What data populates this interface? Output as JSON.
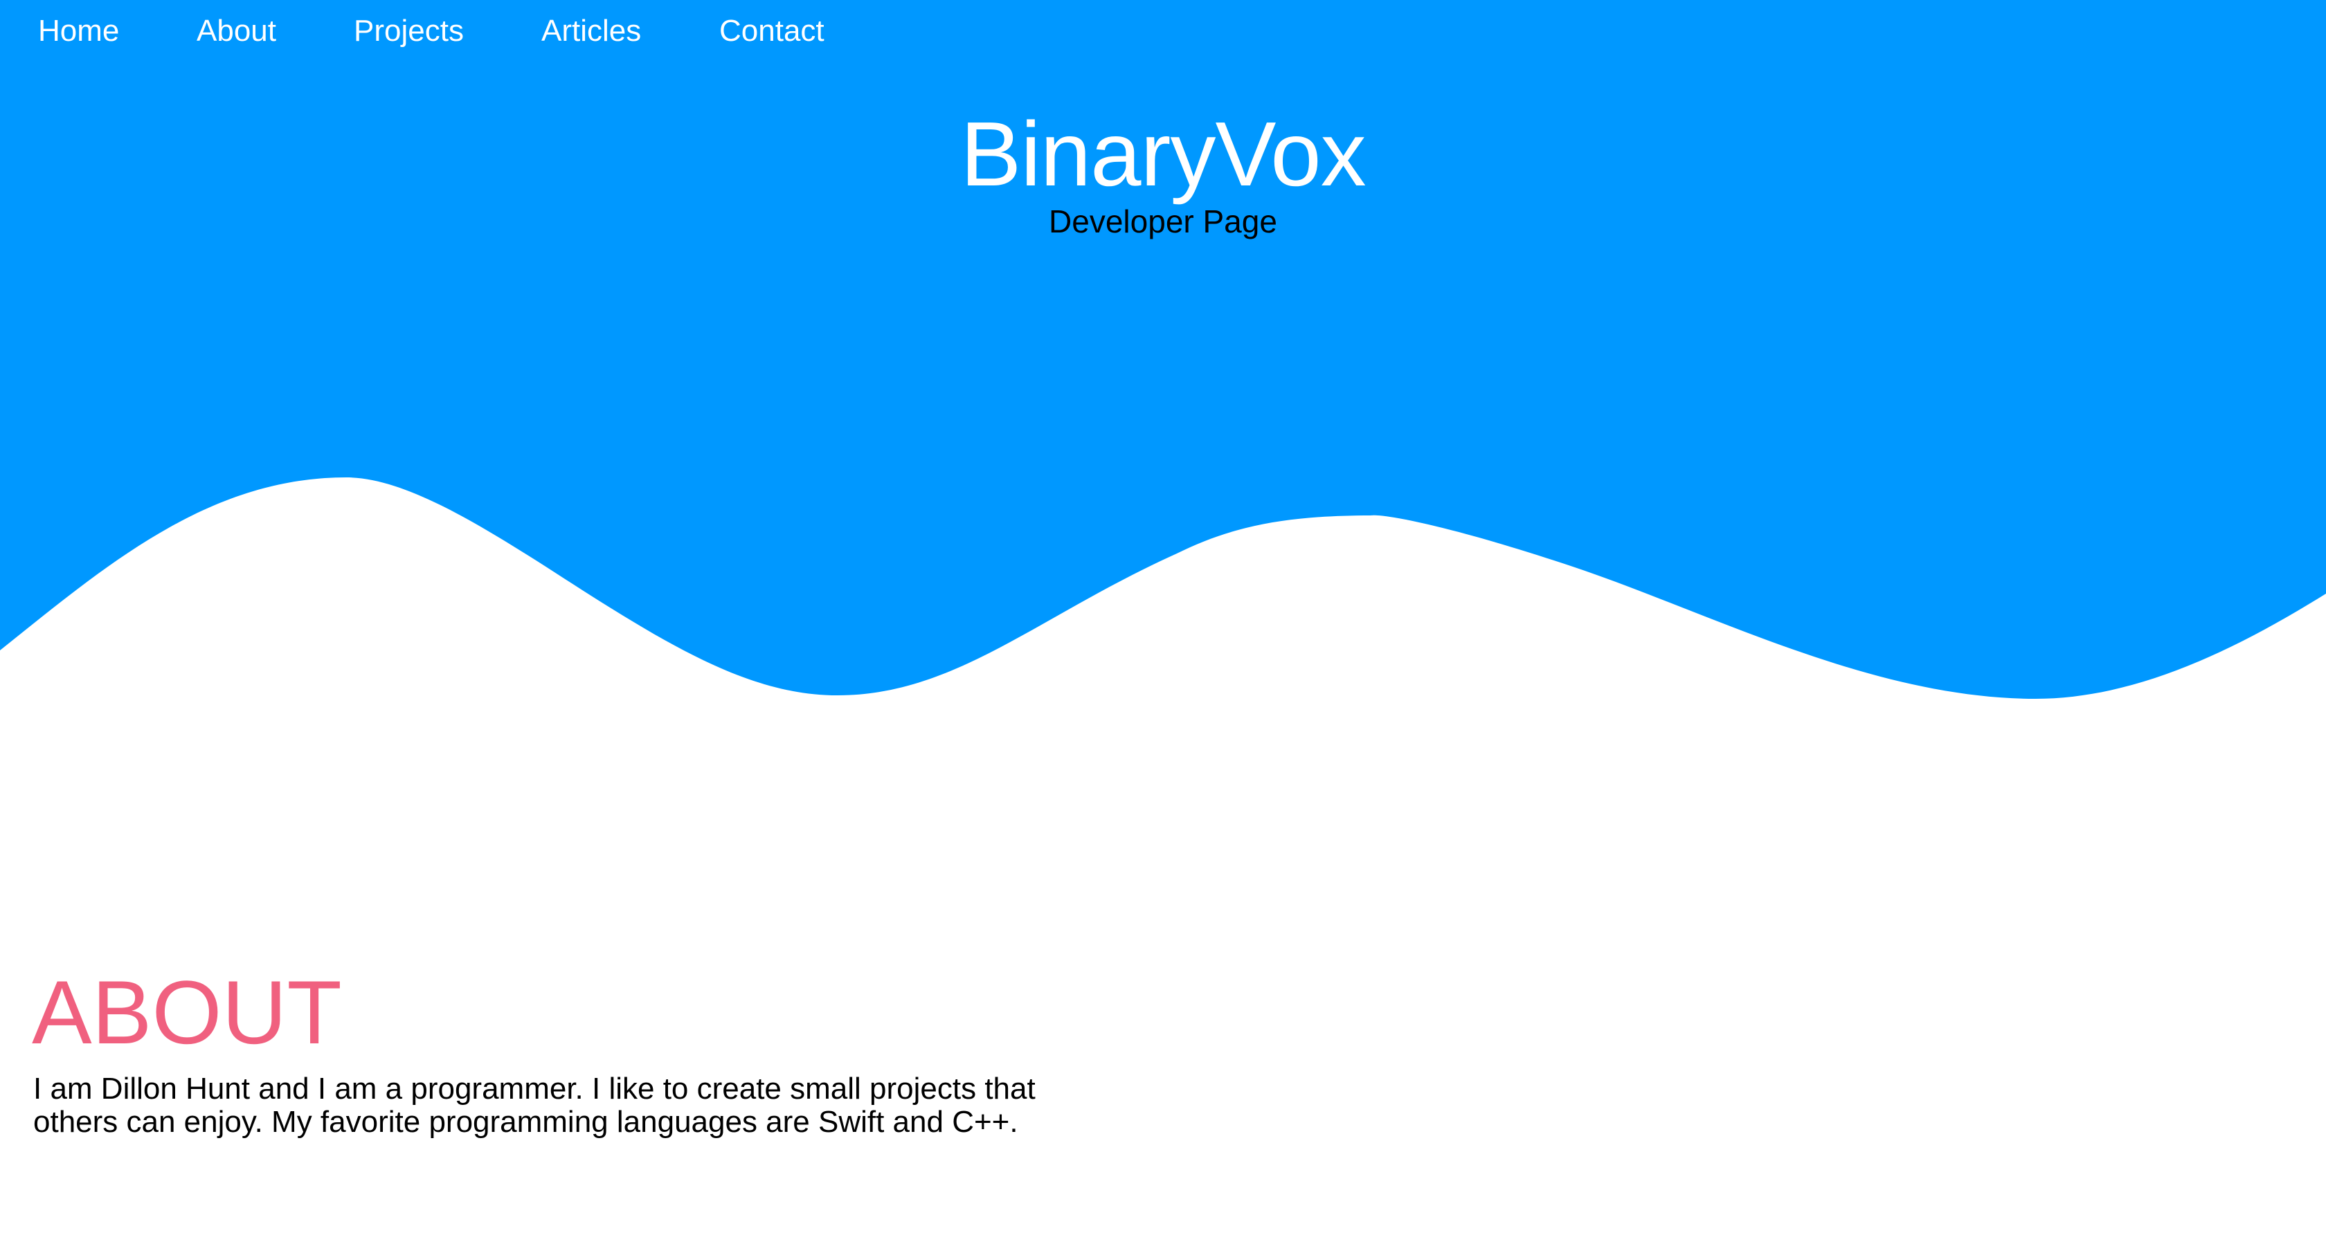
{
  "nav": {
    "items": [
      {
        "label": "Home"
      },
      {
        "label": "About"
      },
      {
        "label": "Projects"
      },
      {
        "label": "Articles"
      },
      {
        "label": "Contact"
      }
    ]
  },
  "hero": {
    "title": "BinaryVox",
    "subtitle": "Developer Page"
  },
  "about": {
    "heading": "ABOUT",
    "text": "I am Dillon Hunt and I am a programmer. I like to create small projects that others can enjoy. My favorite programming languages are Swift and C++."
  },
  "colors": {
    "hero_blue": "#0098ff",
    "accent_pink": "#f0607f",
    "text_dark": "#000000",
    "text_light": "#ffffff"
  }
}
